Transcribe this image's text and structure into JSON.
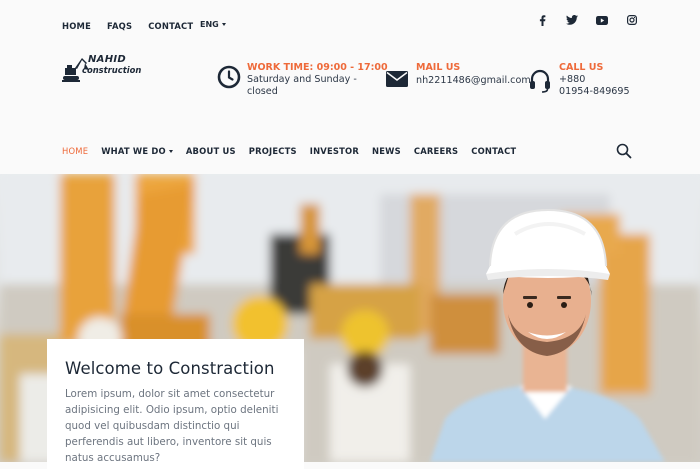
{
  "topbar": {
    "links": [
      "HOME",
      "FAQS",
      "CONTACT"
    ],
    "language": "ENG"
  },
  "social": [
    "facebook-icon",
    "twitter-icon",
    "youtube-icon",
    "instagram-icon"
  ],
  "logo": {
    "line1": "NAHID",
    "line2": "construction"
  },
  "info": {
    "work": {
      "title": "WORK TIME: 09:00 - 17:00",
      "line1": "Saturday and Sunday -",
      "line2": "closed"
    },
    "mail": {
      "title": "MAIL US",
      "line1": "nh2211486@gmail.com"
    },
    "call": {
      "title": "CALL US",
      "line1": "+880",
      "line2": "01954-849695"
    }
  },
  "nav": {
    "items": [
      "HOME",
      "WHAT WE DO",
      "ABOUT US",
      "PROJECTS",
      "INVESTOR",
      "NEWS",
      "CAREERS",
      "CONTACT"
    ]
  },
  "hero": {
    "title": "Welcome to Constraction",
    "text": "Lorem ipsum, dolor sit amet consectetur adipisicing elit. Odio ipsum, optio deleniti quod vel quibusdam distinctio qui perferendis aut libero, inventore sit quis natus accusamus?"
  },
  "colors": {
    "accent": "#ee6a3a",
    "dark": "#1d2836"
  }
}
